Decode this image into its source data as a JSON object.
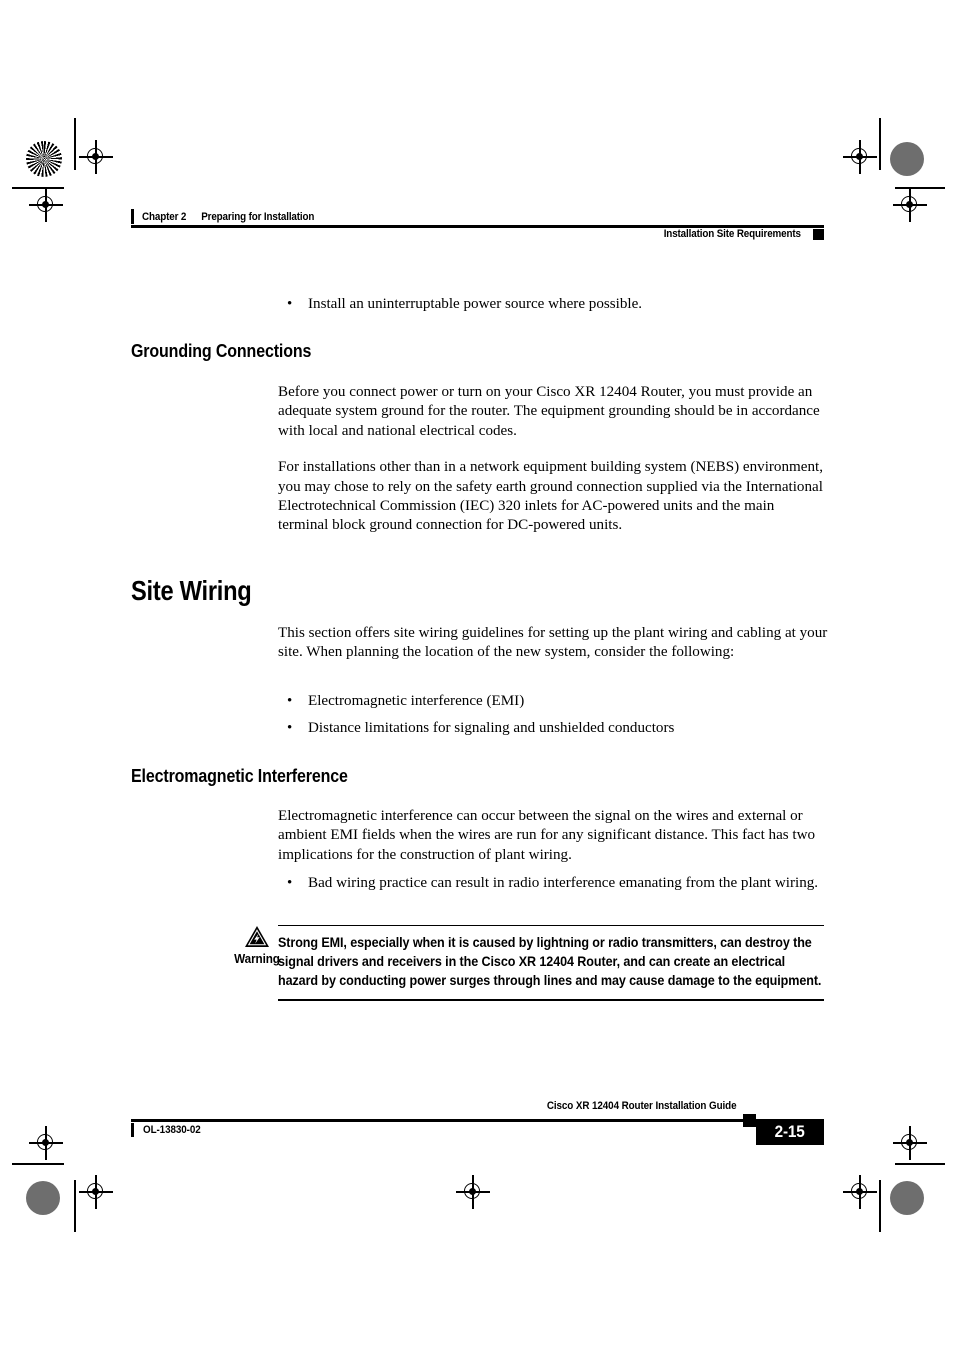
{
  "document": {
    "header": {
      "chapter_number": "Chapter 2",
      "chapter_title": "Preparing for Installation",
      "section_title": "Installation Site Requirements"
    },
    "footer": {
      "doc_id": "OL-13830-02",
      "guide_title": "Cisco XR 12404 Router Installation Guide",
      "page_number": "2-15"
    }
  },
  "content": {
    "intro_bullet": "Install an uninterruptable power source where possible.",
    "grounding": {
      "heading": "Grounding Connections",
      "para1": "Before you connect power or turn on your Cisco XR 12404 Router, you must provide an adequate system ground for the router. The equipment grounding should be in accordance with local and national electrical codes.",
      "para2": "For installations other than in a network equipment building system (NEBS) environment, you may chose to rely on the safety earth ground connection supplied via the International Electrotechnical Commission (IEC) 320 inlets for AC-powered units and the main terminal block ground connection for DC-powered units."
    },
    "site_wiring": {
      "heading": "Site Wiring",
      "para1": "This section offers site wiring guidelines for setting up the plant wiring and cabling at your site. When planning the location of the new system, consider the following:",
      "bullets": [
        "Electromagnetic interference (EMI)",
        "Distance limitations for signaling and unshielded conductors"
      ]
    },
    "emi": {
      "heading": "Electromagnetic Interference",
      "para1": "Electromagnetic interference can occur between the signal on the wires and external or ambient EMI fields when the wires are run for any significant distance. This fact has two implications for the construction of plant wiring.",
      "bullets": [
        "Bad wiring practice can result in radio interference emanating from the plant wiring."
      ]
    },
    "warning": {
      "label": "Warning",
      "icon": "warning-triangle-lightning-icon",
      "text": "Strong EMI, especially when it is caused by lightning or radio transmitters, can destroy the signal drivers and receivers in the Cisco XR 12404 Router, and can create an electrical hazard by conducting power surges through lines and may cause damage to the equipment."
    }
  },
  "bullet_glyph": "•",
  "colors": {
    "text": "#000000",
    "page_background": "#ffffff",
    "registration_gray": "#6e6e6e",
    "page_number_background": "#000000",
    "page_number_text": "#ffffff"
  }
}
